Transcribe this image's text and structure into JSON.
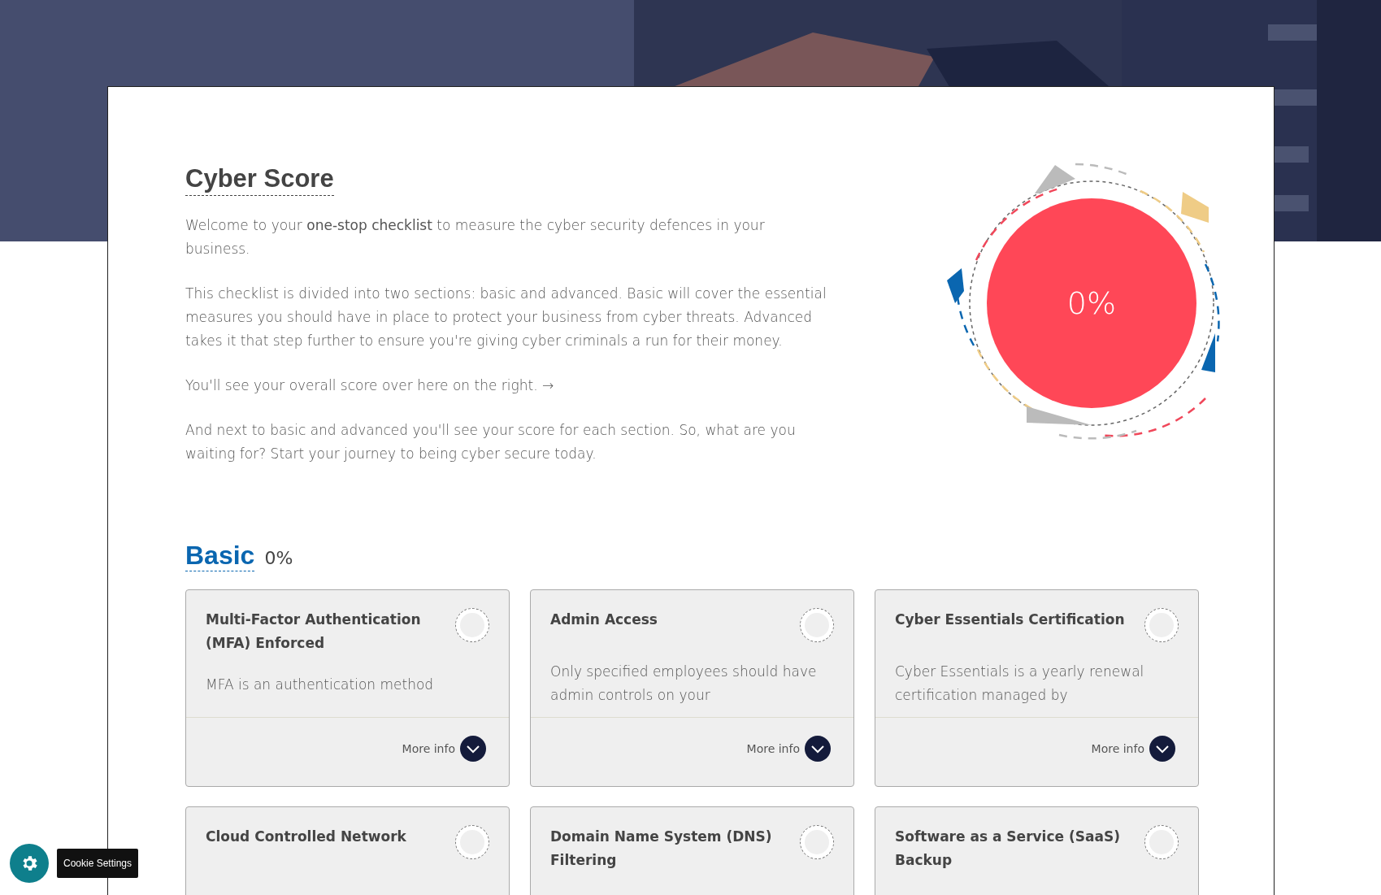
{
  "intro": {
    "title": "Cyber Score",
    "paragraphs": [
      "Welcome to your **one-stop checklist** to measure the cyber security defences in your business.",
      "This checklist is divided into two sections: basic and advanced. Basic will cover the essential measures you should have in place to protect your business from cyber threats. Advanced takes it that step further to ensure you're giving cyber criminals a run for their money.",
      "You'll see your overall score over here on the right. →",
      "And next to basic and advanced you'll see your score for each section. So, what are you waiting for? Start your journey to being cyber secure today."
    ],
    "overall_score": "0%"
  },
  "section": {
    "title": "Basic",
    "score": "0%",
    "cards": [
      {
        "title": "Multi-Factor Authentication (MFA) Enforced",
        "description": "MFA is an authentication method",
        "more_info": "More info",
        "checked": false
      },
      {
        "title": "Admin Access",
        "description": "Only specified employees should have admin controls on your",
        "more_info": "More info",
        "checked": false
      },
      {
        "title": "Cyber Essentials Certification",
        "description": "Cyber Essentials is a yearly renewal certification managed by",
        "more_info": "More info",
        "checked": false
      },
      {
        "title": "Cloud Controlled Network",
        "checked": false
      },
      {
        "title": "Domain Name System (DNS) Filtering",
        "checked": false
      },
      {
        "title": "Software as a Service (SaaS) Backup",
        "checked": false
      }
    ]
  },
  "cookie": {
    "tooltip": "Cookie Settings"
  }
}
